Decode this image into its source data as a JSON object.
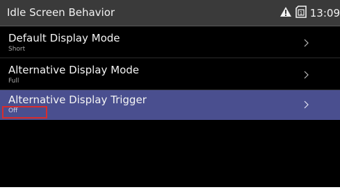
{
  "header": {
    "title": "Idle Screen Behavior",
    "time": "13:09",
    "icons": {
      "warning": "warning-icon",
      "sim": "sim-card-icon",
      "sim_label": "1"
    }
  },
  "menu": {
    "items": [
      {
        "title": "Default Display Mode",
        "value": "Short",
        "selected": false
      },
      {
        "title": "Alternative Display Mode",
        "value": "Full",
        "selected": false
      },
      {
        "title": "Alternative Display Trigger",
        "value": "Off",
        "selected": true
      }
    ]
  },
  "colors": {
    "header_bg": "#3a3a3a",
    "screen_bg": "#000000",
    "selected_row_bg": "#4a4f8f",
    "focus_outline": "#d92c2c",
    "text_primary": "#f4f4f4",
    "text_secondary": "#a9a9a9"
  }
}
